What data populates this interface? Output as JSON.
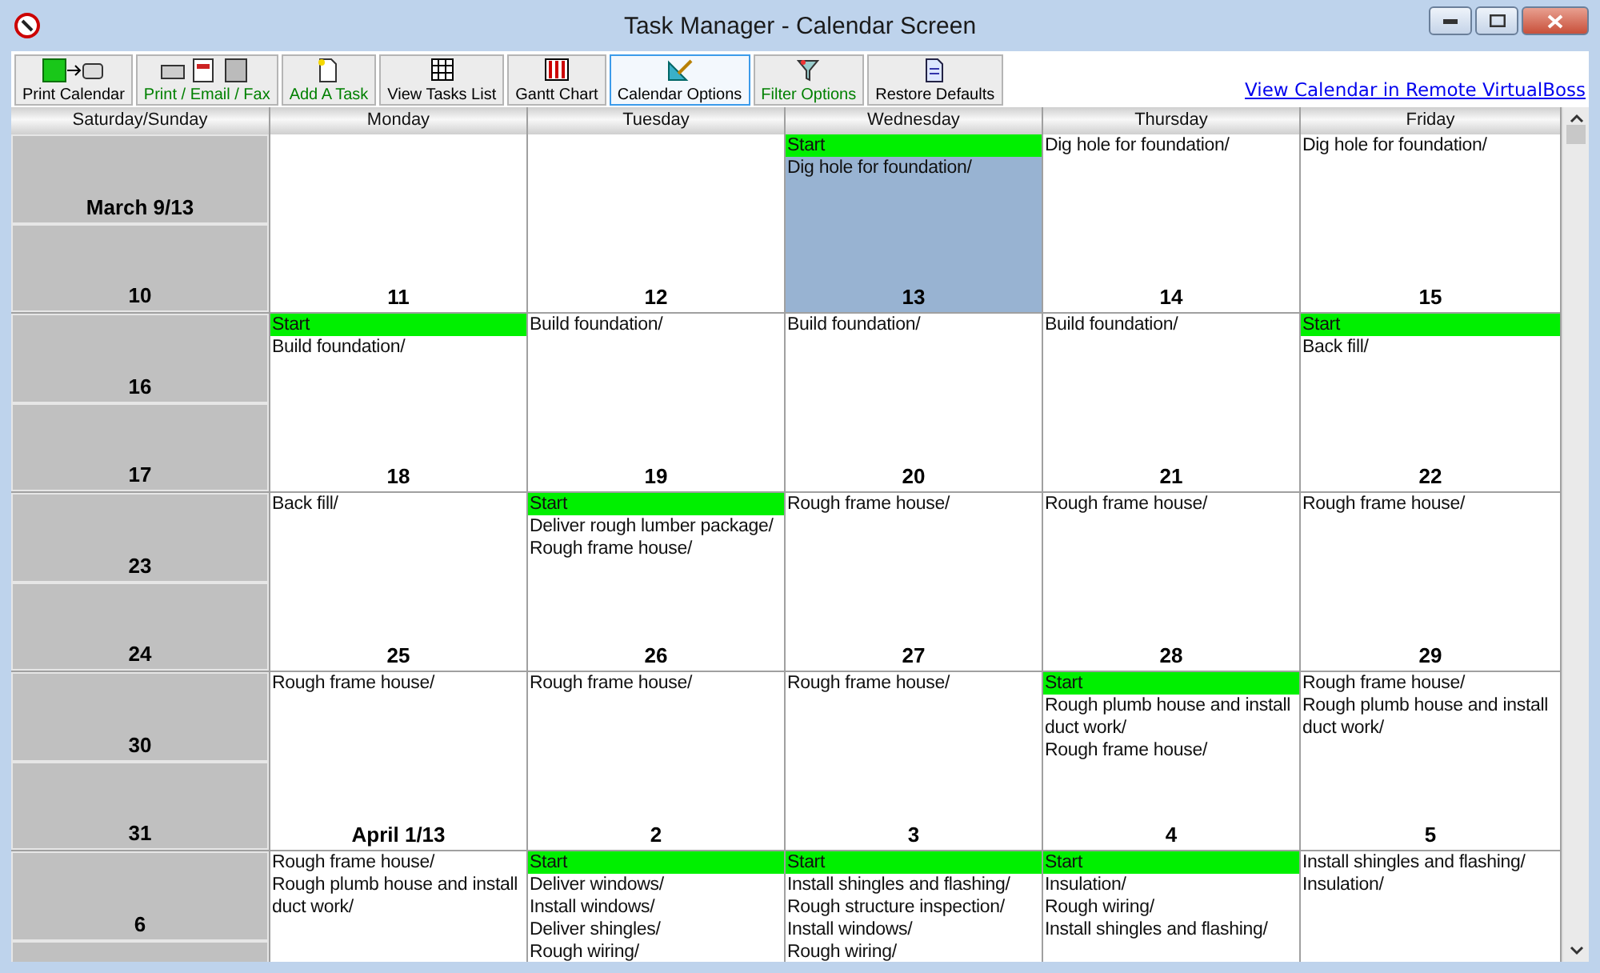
{
  "window": {
    "title": "Task Manager - Calendar Screen"
  },
  "toolbar": {
    "buttons": [
      {
        "label": "Print Calendar",
        "color": "#000000",
        "selected": false
      },
      {
        "label": "Print / Email / Fax",
        "color": "#008000",
        "selected": false
      },
      {
        "label": "Add A Task",
        "color": "#008000",
        "selected": false
      },
      {
        "label": "View Tasks List",
        "color": "#000000",
        "selected": false
      },
      {
        "label": "Gantt Chart",
        "color": "#000000",
        "selected": false
      },
      {
        "label": "Calendar Options",
        "color": "#000000",
        "selected": true
      },
      {
        "label": "Filter Options",
        "color": "#008000",
        "selected": false
      },
      {
        "label": "Restore Defaults",
        "color": "#000000",
        "selected": false
      }
    ],
    "link": "View Calendar in Remote VirtualBoss"
  },
  "columns": [
    "Saturday/Sunday",
    "Monday",
    "Tuesday",
    "Wednesday",
    "Thursday",
    "Friday"
  ],
  "weeks": [
    {
      "weekend": [
        "March 9/13",
        "10"
      ],
      "days": [
        {
          "date": "11",
          "selected": false
        },
        {
          "date": "12",
          "selected": false
        },
        {
          "date": "13",
          "selected": true,
          "entries": [
            {
              "kind": "start",
              "text": "Start"
            },
            {
              "kind": "task",
              "text": "Dig hole for foundation/"
            }
          ]
        },
        {
          "date": "14",
          "selected": false,
          "entries": [
            {
              "kind": "task",
              "text": "Dig hole for foundation/"
            }
          ]
        },
        {
          "date": "15",
          "selected": false,
          "entries": [
            {
              "kind": "task",
              "text": "Dig hole for foundation/"
            }
          ]
        }
      ]
    },
    {
      "weekend": [
        "16",
        "17"
      ],
      "days": [
        {
          "date": "18",
          "selected": false,
          "entries": [
            {
              "kind": "start",
              "text": "Start"
            },
            {
              "kind": "task",
              "text": "Build foundation/"
            }
          ]
        },
        {
          "date": "19",
          "selected": false,
          "entries": [
            {
              "kind": "task",
              "text": "Build foundation/"
            }
          ]
        },
        {
          "date": "20",
          "selected": false,
          "entries": [
            {
              "kind": "task",
              "text": "Build foundation/"
            }
          ]
        },
        {
          "date": "21",
          "selected": false,
          "entries": [
            {
              "kind": "task",
              "text": "Build foundation/"
            }
          ]
        },
        {
          "date": "22",
          "selected": false,
          "entries": [
            {
              "kind": "start",
              "text": "Start"
            },
            {
              "kind": "task",
              "text": "Back fill/"
            }
          ]
        }
      ]
    },
    {
      "weekend": [
        "23",
        "24"
      ],
      "days": [
        {
          "date": "25",
          "selected": false,
          "entries": [
            {
              "kind": "task",
              "text": "Back fill/"
            }
          ]
        },
        {
          "date": "26",
          "selected": false,
          "entries": [
            {
              "kind": "start",
              "text": "Start"
            },
            {
              "kind": "task",
              "text": "Deliver rough lumber package/"
            },
            {
              "kind": "task",
              "text": "Rough frame house/"
            }
          ]
        },
        {
          "date": "27",
          "selected": false,
          "entries": [
            {
              "kind": "task",
              "text": "Rough frame house/"
            }
          ]
        },
        {
          "date": "28",
          "selected": false,
          "entries": [
            {
              "kind": "task",
              "text": "Rough frame house/"
            }
          ]
        },
        {
          "date": "29",
          "selected": false,
          "entries": [
            {
              "kind": "task",
              "text": "Rough frame house/"
            }
          ]
        }
      ]
    },
    {
      "weekend": [
        "30",
        "31"
      ],
      "days": [
        {
          "date": "April 1/13",
          "selected": false,
          "entries": [
            {
              "kind": "task",
              "text": "Rough frame house/"
            }
          ]
        },
        {
          "date": "2",
          "selected": false,
          "entries": [
            {
              "kind": "task",
              "text": "Rough frame house/"
            }
          ]
        },
        {
          "date": "3",
          "selected": false,
          "entries": [
            {
              "kind": "task",
              "text": "Rough frame house/"
            }
          ]
        },
        {
          "date": "4",
          "selected": false,
          "entries": [
            {
              "kind": "start",
              "text": "Start"
            },
            {
              "kind": "task",
              "text": "Rough plumb house and install duct work/"
            },
            {
              "kind": "task",
              "text": "Rough frame house/"
            }
          ]
        },
        {
          "date": "5",
          "selected": false,
          "entries": [
            {
              "kind": "task",
              "text": "Rough frame house/"
            },
            {
              "kind": "task",
              "text": "Rough plumb house and install duct work/"
            }
          ]
        }
      ]
    },
    {
      "weekend": [
        "6"
      ],
      "days": [
        {
          "selected": false,
          "entries": [
            {
              "kind": "task",
              "text": "Rough frame house/"
            },
            {
              "kind": "task",
              "text": "Rough plumb house and install duct work/"
            }
          ]
        },
        {
          "selected": false,
          "entries": [
            {
              "kind": "start",
              "text": "Start"
            },
            {
              "kind": "task",
              "text": "Deliver windows/"
            },
            {
              "kind": "task",
              "text": "Install windows/"
            },
            {
              "kind": "task",
              "text": "Deliver shingles/"
            },
            {
              "kind": "task",
              "text": "Rough wiring/"
            }
          ]
        },
        {
          "selected": false,
          "entries": [
            {
              "kind": "start",
              "text": "Start"
            },
            {
              "kind": "task",
              "text": "Install shingles and flashing/"
            },
            {
              "kind": "task",
              "text": "Rough structure inspection/"
            },
            {
              "kind": "task",
              "text": "Install windows/"
            },
            {
              "kind": "task",
              "text": "Rough wiring/"
            }
          ]
        },
        {
          "selected": false,
          "entries": [
            {
              "kind": "start",
              "text": "Start"
            },
            {
              "kind": "task",
              "text": "Insulation/"
            },
            {
              "kind": "task",
              "text": "Rough wiring/"
            },
            {
              "kind": "task",
              "text": "Install shingles and flashing/"
            }
          ]
        },
        {
          "selected": false,
          "entries": [
            {
              "kind": "task",
              "text": "Install shingles and flashing/"
            },
            {
              "kind": "task",
              "text": "Insulation/"
            }
          ]
        }
      ]
    }
  ]
}
